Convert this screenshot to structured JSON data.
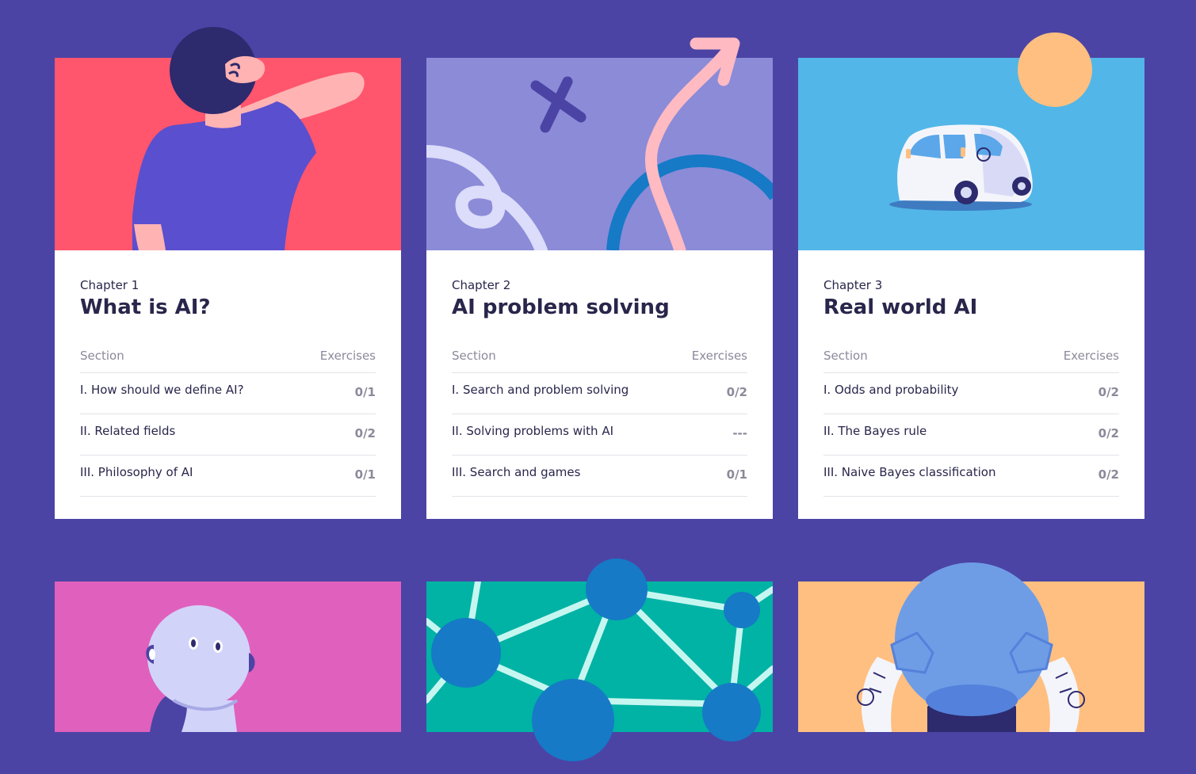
{
  "colors": {
    "page_bg": "#4b44a5",
    "card1_art": "#ff556d",
    "card2_art": "#8b8bd8",
    "card3_art": "#52b6e8",
    "card4_art": "#e060bd",
    "card5_art": "#00b3a5",
    "card6_art": "#ffbf80",
    "text": "#29264b",
    "muted": "#8b8a9b"
  },
  "chapters": [
    {
      "chapter_label": "Chapter 1",
      "title": "What is AI?",
      "section_header": "Section",
      "exercises_header": "Exercises",
      "illustration": "person-scratching-head-illustration",
      "sections": [
        {
          "name": "I. How should we define AI?",
          "exercises": "0/1"
        },
        {
          "name": "II. Related fields",
          "exercises": "0/2"
        },
        {
          "name": "III. Philosophy of AI",
          "exercises": "0/1"
        }
      ]
    },
    {
      "chapter_label": "Chapter 2",
      "title": "AI problem solving",
      "section_header": "Section",
      "exercises_header": "Exercises",
      "illustration": "path-and-arrow-illustration",
      "sections": [
        {
          "name": "I. Search and problem solving",
          "exercises": "0/2"
        },
        {
          "name": "II. Solving problems with AI",
          "exercises": "---"
        },
        {
          "name": "III. Search and games",
          "exercises": "0/1"
        }
      ]
    },
    {
      "chapter_label": "Chapter 3",
      "title": "Real world AI",
      "section_header": "Section",
      "exercises_header": "Exercises",
      "illustration": "self-driving-car-illustration",
      "sections": [
        {
          "name": "I. Odds and probability",
          "exercises": "0/2"
        },
        {
          "name": "II. The Bayes rule",
          "exercises": "0/2"
        },
        {
          "name": "III. Naive Bayes classification",
          "exercises": "0/2"
        }
      ]
    },
    {
      "illustration": "robot-head-illustration"
    },
    {
      "illustration": "neural-network-illustration"
    },
    {
      "illustration": "robot-hands-sphere-illustration"
    }
  ]
}
